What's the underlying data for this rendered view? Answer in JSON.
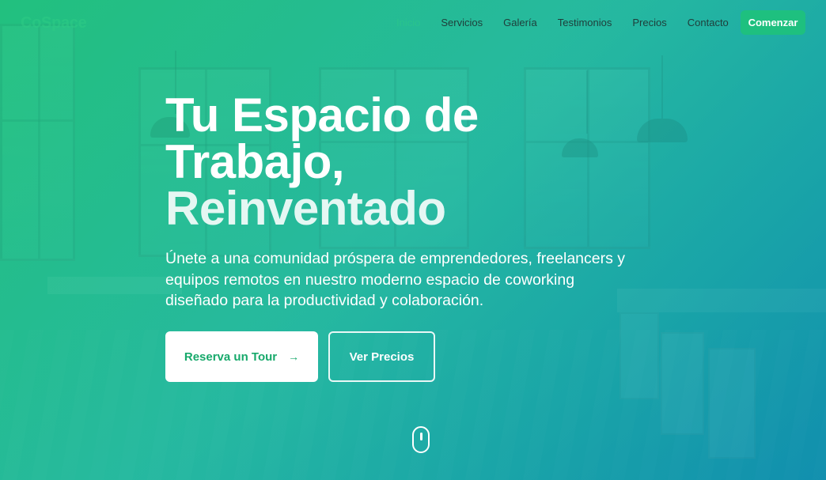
{
  "brand": {
    "logo": "CoSpace"
  },
  "nav": {
    "links": [
      "Inicio",
      "Servicios",
      "Galería",
      "Testimonios",
      "Precios",
      "Contacto"
    ],
    "cta_label": "Comenzar"
  },
  "hero": {
    "title_lines": [
      "Tu Espacio de",
      "Trabajo,",
      "Reinventado"
    ],
    "subtitle_lines": [
      "Únete a una comunidad próspera de emprendedores, freelancers y",
      "equipos remotos en nuestro moderno espacio de coworking",
      "diseñado para la productividad y colaboración."
    ],
    "primary_button": "Reserva un Tour",
    "primary_icon": "arrow-right-icon",
    "secondary_button": "Ver Precios",
    "scroll_icon": "mouse-scroll-icon"
  },
  "colors": {
    "accent": "#1ec07f",
    "gradient_start": "#22c07e",
    "gradient_end": "#118fae",
    "text": "#ffffff"
  }
}
